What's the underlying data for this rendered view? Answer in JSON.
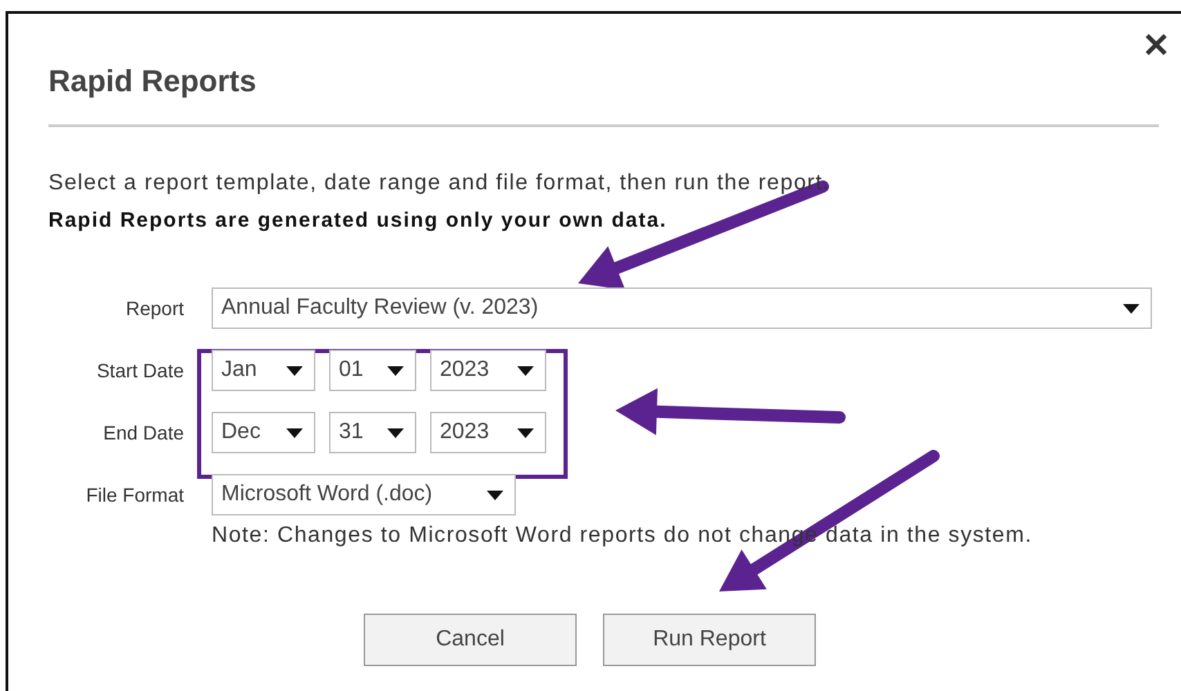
{
  "dialog": {
    "title": "Rapid Reports",
    "close": "✕",
    "instructions": "Select a report template, date range and file format, then run the report.",
    "notice": "Rapid Reports are generated using only your own data.",
    "fields": [
      {
        "label": "Report",
        "dropdowns": [
          {
            "value": "Annual Faculty Review (v. 2023)",
            "kind": "wide"
          }
        ]
      },
      {
        "label": "Start Date",
        "dropdowns": [
          {
            "value": "Jan",
            "kind": "month"
          },
          {
            "value": "01",
            "kind": "day"
          },
          {
            "value": "2023",
            "kind": "year"
          }
        ]
      },
      {
        "label": "End Date",
        "dropdowns": [
          {
            "value": "Dec",
            "kind": "month"
          },
          {
            "value": "31",
            "kind": "day"
          },
          {
            "value": "2023",
            "kind": "year"
          }
        ]
      },
      {
        "label": "File Format",
        "dropdowns": [
          {
            "value": "Microsoft Word (.doc)",
            "kind": "format"
          }
        ],
        "note": "Note: Changes to Microsoft Word reports do not change data in the system."
      }
    ],
    "buttons": [
      "Cancel",
      "Run Report"
    ]
  },
  "annotations": [
    {
      "kind": "arrow"
    },
    {
      "kind": "frame"
    },
    {
      "kind": "arrow"
    },
    {
      "kind": "arrow"
    }
  ]
}
